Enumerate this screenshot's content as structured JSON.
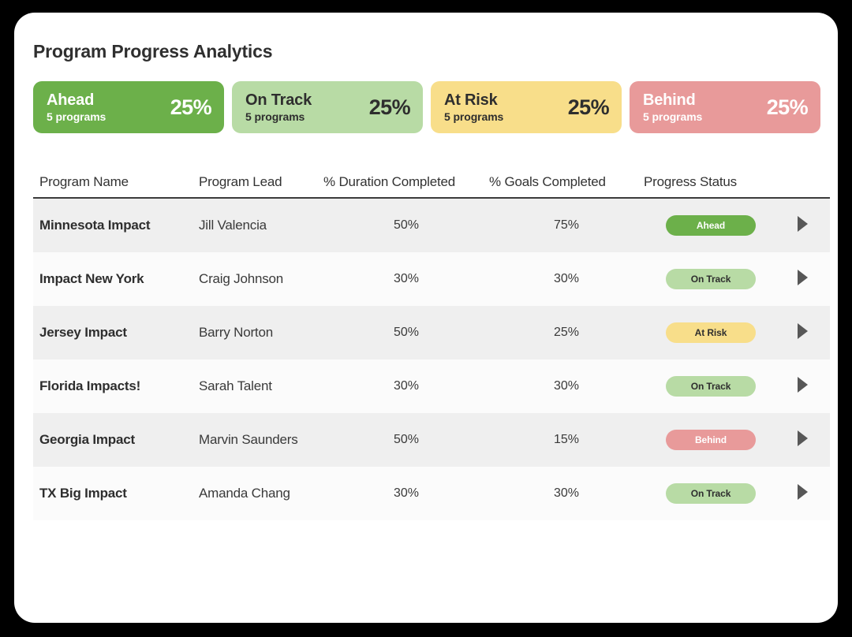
{
  "page": {
    "title": "Program Progress Analytics"
  },
  "summary_cards": [
    {
      "label": "Ahead",
      "subtitle": "5 programs",
      "percent": "25%",
      "bg": "#6cb04a",
      "fg": "#ffffff"
    },
    {
      "label": "On Track",
      "subtitle": "5 programs",
      "percent": "25%",
      "bg": "#b8dba5",
      "fg": "#2e2e2e"
    },
    {
      "label": "At Risk",
      "subtitle": "5 programs",
      "percent": "25%",
      "bg": "#f8de8a",
      "fg": "#2e2e2e"
    },
    {
      "label": "Behind",
      "subtitle": "5 programs",
      "percent": "25%",
      "bg": "#e89a9a",
      "fg": "#ffffff"
    }
  ],
  "table": {
    "columns": [
      "Program Name",
      "Program Lead",
      "% Duration Completed",
      "% Goals Completed",
      "Progress Status"
    ],
    "rows": [
      {
        "program_name": "Minnesota Impact",
        "program_lead": "Jill Valencia",
        "duration_completed": "50%",
        "goals_completed": "75%",
        "status": "Ahead",
        "status_bg": "#6cb04a",
        "status_fg": "#ffffff"
      },
      {
        "program_name": "Impact New York",
        "program_lead": "Craig Johnson",
        "duration_completed": "30%",
        "goals_completed": "30%",
        "status": "On Track",
        "status_bg": "#b8dba5",
        "status_fg": "#2e2e2e"
      },
      {
        "program_name": "Jersey Impact",
        "program_lead": "Barry Norton",
        "duration_completed": "50%",
        "goals_completed": "25%",
        "status": "At Risk",
        "status_bg": "#f8de8a",
        "status_fg": "#2e2e2e"
      },
      {
        "program_name": "Florida Impacts!",
        "program_lead": "Sarah Talent",
        "duration_completed": "30%",
        "goals_completed": "30%",
        "status": "On Track",
        "status_bg": "#b8dba5",
        "status_fg": "#2e2e2e"
      },
      {
        "program_name": "Georgia Impact",
        "program_lead": "Marvin Saunders",
        "duration_completed": "50%",
        "goals_completed": "15%",
        "status": "Behind",
        "status_bg": "#e89a9a",
        "status_fg": "#ffffff"
      },
      {
        "program_name": "TX Big Impact",
        "program_lead": "Amanda Chang",
        "duration_completed": "30%",
        "goals_completed": "30%",
        "status": "On Track",
        "status_bg": "#b8dba5",
        "status_fg": "#2e2e2e"
      }
    ],
    "row_expand_icon": "caret-right-icon"
  }
}
